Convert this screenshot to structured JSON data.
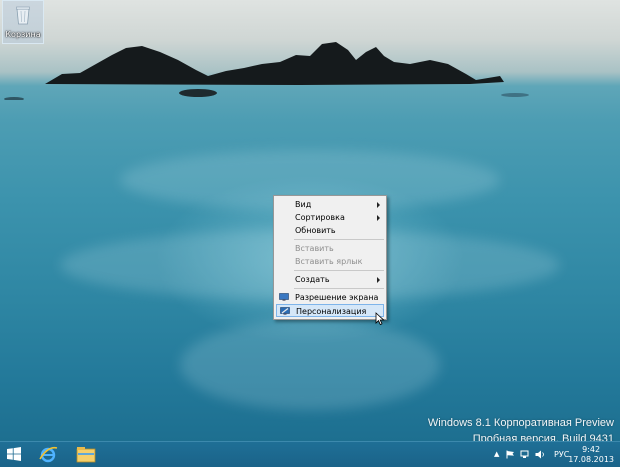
{
  "desktop": {
    "icons": [
      {
        "label": "Корзина",
        "icon": "recycle-bin-icon"
      }
    ]
  },
  "context_menu": {
    "items": [
      {
        "label": "Вид",
        "submenu": true,
        "enabled": true
      },
      {
        "label": "Сортировка",
        "submenu": true,
        "enabled": true
      },
      {
        "label": "Обновить",
        "submenu": false,
        "enabled": true
      },
      {
        "label": "Вставить",
        "submenu": false,
        "enabled": false
      },
      {
        "label": "Вставить ярлык",
        "submenu": false,
        "enabled": false
      },
      {
        "label": "Создать",
        "submenu": true,
        "enabled": true
      },
      {
        "label": "Разрешение экрана",
        "submenu": false,
        "enabled": true,
        "icon": "display-resolution-icon"
      },
      {
        "label": "Персонализация",
        "submenu": false,
        "enabled": true,
        "icon": "personalization-icon",
        "highlighted": true
      }
    ]
  },
  "watermark": {
    "line1": "Windows 8.1 Корпоративная Preview",
    "line2": "Пробная версия. Build 9431"
  },
  "taskbar": {
    "pinned": [
      "windows-start-icon",
      "internet-explorer-icon",
      "file-explorer-icon"
    ],
    "tray": {
      "language": "РУС",
      "time": "9:42",
      "date": "17.08.2013"
    }
  },
  "colors": {
    "taskbar": "#1a6389",
    "menu_background": "#f0f0f0",
    "menu_highlight": "#d5e7f8"
  }
}
